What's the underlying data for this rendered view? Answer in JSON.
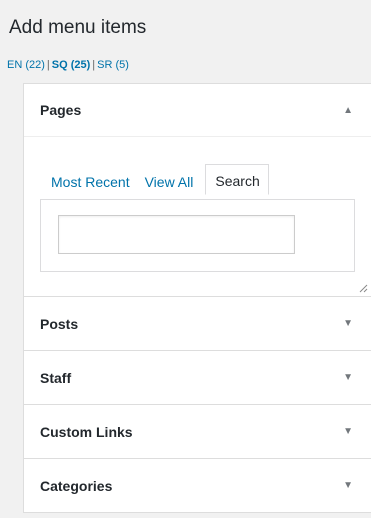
{
  "header": {
    "title": "Add menu items"
  },
  "languages": [
    {
      "label": "EN (22)",
      "current": false
    },
    {
      "label": "SQ (25)",
      "current": true
    },
    {
      "label": "SR (5)",
      "current": false
    }
  ],
  "language_separator": "|",
  "pages": {
    "title": "Pages",
    "arrow": "▲",
    "tabs": [
      {
        "label": "Most Recent",
        "active": false
      },
      {
        "label": "View All",
        "active": false
      },
      {
        "label": "Search",
        "active": true
      }
    ],
    "search": {
      "value": "",
      "placeholder": ""
    }
  },
  "sections": [
    {
      "title": "Posts",
      "arrow": "▼"
    },
    {
      "title": "Staff",
      "arrow": "▼"
    },
    {
      "title": "Custom Links",
      "arrow": "▼"
    },
    {
      "title": "Categories",
      "arrow": "▼"
    }
  ],
  "colors": {
    "link": "#0073aa",
    "text": "#23282d",
    "background": "#f1f1f1",
    "border": "#dddddd"
  },
  "icons": {
    "collapse": "triangle-up-icon",
    "expand": "triangle-down-icon",
    "resize": "resize-handle-icon"
  }
}
